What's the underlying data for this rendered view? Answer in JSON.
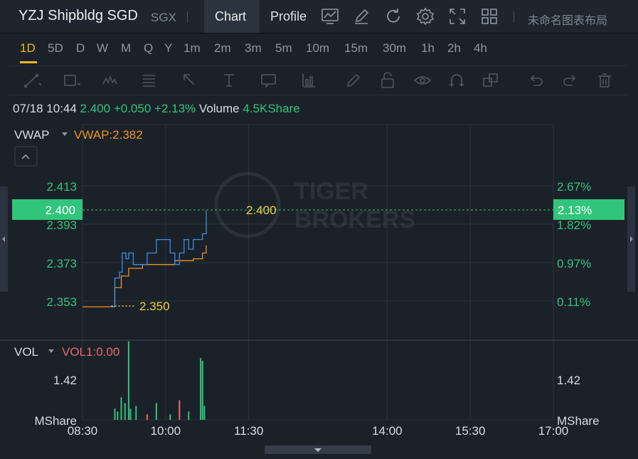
{
  "header": {
    "title": "YZJ Shipbldg SGD",
    "exchange": "SGX",
    "tabs": [
      {
        "label": "Chart",
        "active": true
      },
      {
        "label": "Profile",
        "active": false
      }
    ],
    "icons": [
      "indicator-chart-icon",
      "draw-pen-icon",
      "refresh-icon",
      "settings-gear-icon",
      "fullscreen-icon",
      "layout-grid-icon"
    ],
    "layout_name": "未命名图表布局"
  },
  "periods": [
    "1D",
    "5D",
    "D",
    "W",
    "M",
    "Q",
    "Y",
    "1m",
    "2m",
    "3m",
    "5m",
    "10m",
    "15m",
    "30m",
    "1h",
    "2h",
    "4h"
  ],
  "active_period": "1D",
  "drawing_tools": [
    "line-tool-icon",
    "rectangle-tool-icon",
    "pattern-tool-icon",
    "fibonacci-tool-icon",
    "arrow-tool-icon",
    "text-tool-icon",
    "callout-tool-icon",
    "measure-tool-icon",
    "pen-tool-icon",
    "lock-icon",
    "eye-icon",
    "magnet-icon",
    "layers-icon",
    "undo-icon",
    "redo-icon",
    "trash-icon"
  ],
  "quote": {
    "datetime": "07/18 10:44",
    "price": "2.400",
    "change": "+0.050",
    "change_pct": "+2.13%",
    "volume_label": "Volume",
    "volume": "4.5KShare"
  },
  "price_panel": {
    "indicator": "VWAP",
    "indicator_value": "VWAP:2.382",
    "y_ticks": [
      "2.413",
      "2.393",
      "2.373",
      "2.353"
    ],
    "pct_ticks": [
      "2.67%",
      "1.82%",
      "0.97%",
      "0.11%"
    ],
    "current_price_tag": "2.400",
    "current_pct_tag": "2.13%",
    "high_label": "2.400",
    "low_label": "2.350",
    "watermark_line1": "TIGER",
    "watermark_line2": "BROKERS"
  },
  "volume_panel": {
    "indicator": "VOL",
    "indicator_value": "VOL1:0.00",
    "y_tick": "1.42",
    "unit": "MShare"
  },
  "x_ticks": [
    "08:30",
    "10:00",
    "11:30",
    "14:00",
    "15:30",
    "17:00"
  ],
  "colors": {
    "up": "#31c47b",
    "down": "#ec6b68",
    "vwap": "#e99423",
    "price_line": "#3b8fe3",
    "accent": "#f2b622"
  },
  "chart_data": {
    "type": "line",
    "series": [
      {
        "name": "VWAP",
        "color": "#e99423",
        "x": [
          "08:30",
          "09:00",
          "09:05",
          "09:12",
          "09:20",
          "09:35",
          "09:50",
          "10:10",
          "10:30",
          "10:40",
          "10:44"
        ],
        "y": [
          2.35,
          2.35,
          2.36,
          2.366,
          2.37,
          2.372,
          2.372,
          2.374,
          2.375,
          2.378,
          2.382
        ]
      },
      {
        "color": "#3b8fe3",
        "x": [
          "09:00",
          "09:05",
          "09:10",
          "09:13",
          "09:17",
          "09:20",
          "09:25",
          "09:30",
          "09:40",
          "09:50",
          "10:00",
          "10:05",
          "10:10",
          "10:15",
          "10:20",
          "10:25",
          "10:30",
          "10:35",
          "10:40",
          "10:44"
        ],
        "y": [
          2.35,
          2.365,
          2.368,
          2.378,
          2.375,
          2.378,
          2.372,
          2.372,
          2.378,
          2.385,
          2.385,
          2.378,
          2.372,
          2.378,
          2.385,
          2.38,
          2.385,
          2.385,
          2.388,
          2.4
        ]
      }
    ],
    "volume_bars": {
      "x": [
        "09:05",
        "09:08",
        "09:12",
        "09:16",
        "09:20",
        "09:22",
        "09:28",
        "09:40",
        "09:50",
        "10:05",
        "10:15",
        "10:25",
        "10:38",
        "10:40",
        "10:42"
      ],
      "values": [
        0.4,
        0.3,
        0.8,
        0.6,
        2.8,
        0.4,
        0.5,
        0.2,
        0.6,
        0.2,
        0.7,
        0.3,
        2.2,
        2.1,
        0.5
      ],
      "up": [
        true,
        true,
        true,
        true,
        true,
        true,
        true,
        false,
        true,
        true,
        false,
        true,
        true,
        true,
        true
      ]
    },
    "ylim": [
      2.345,
      2.418
    ],
    "xlim": [
      "08:30",
      "17:00"
    ]
  }
}
